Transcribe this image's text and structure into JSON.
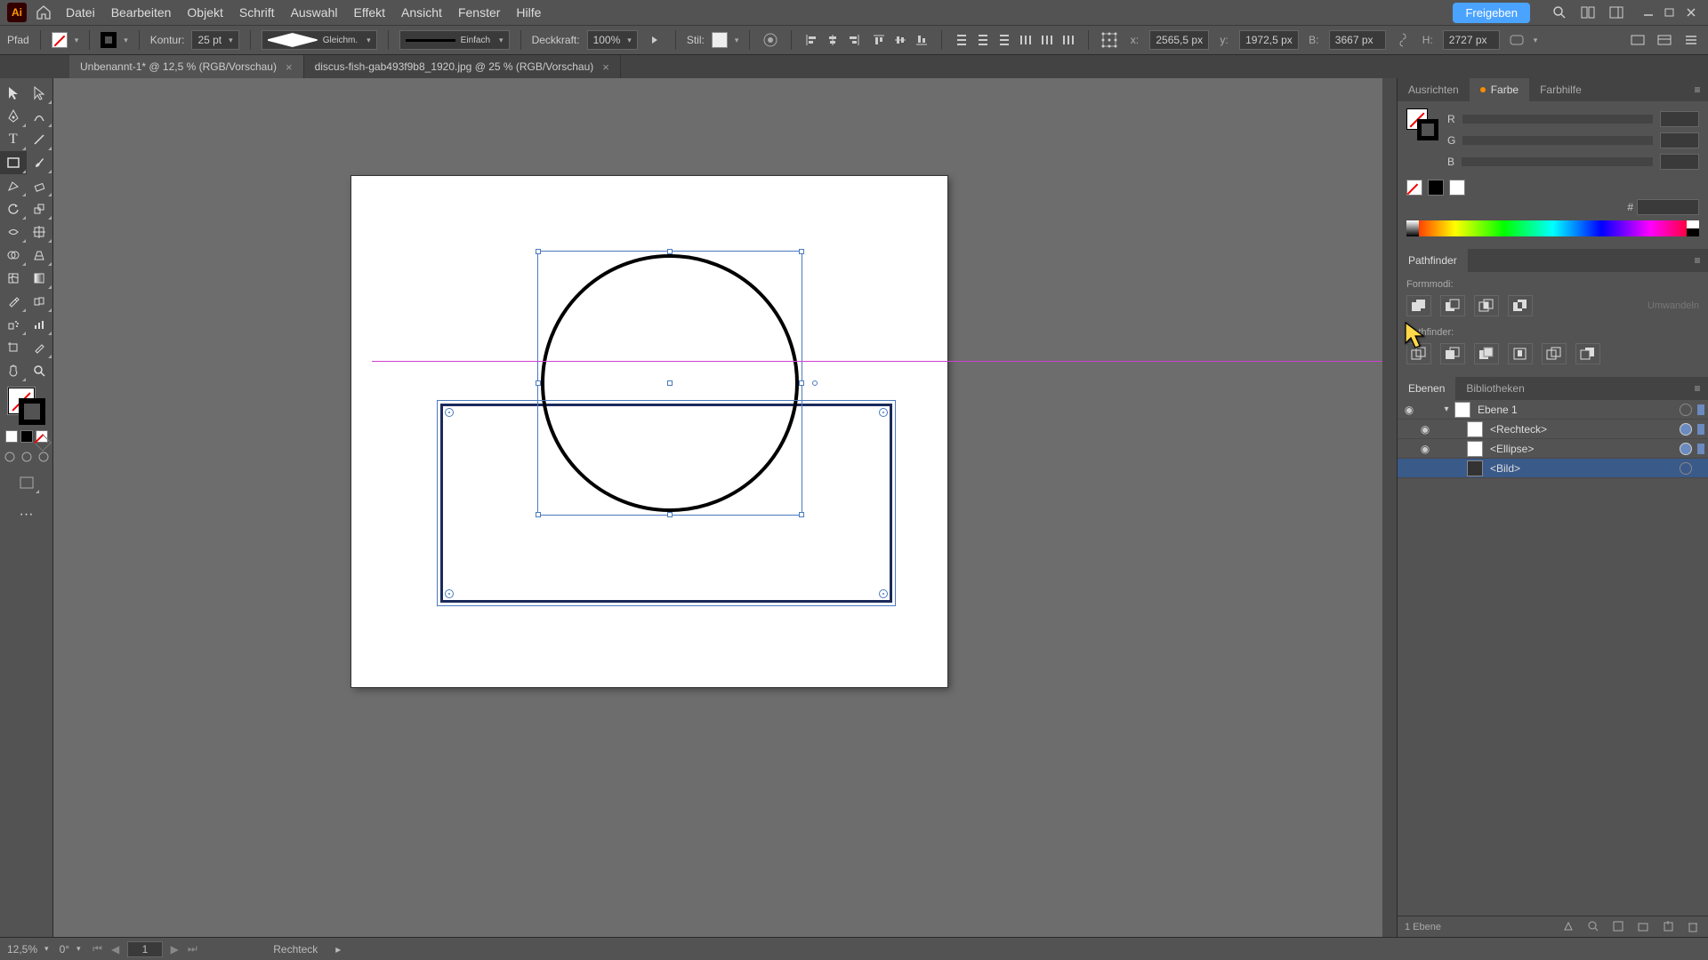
{
  "menubar": {
    "items": [
      "Datei",
      "Bearbeiten",
      "Objekt",
      "Schrift",
      "Auswahl",
      "Effekt",
      "Ansicht",
      "Fenster",
      "Hilfe"
    ],
    "share": "Freigeben"
  },
  "controlbar": {
    "selection_type": "Pfad",
    "kontur_label": "Kontur:",
    "kontur_value": "25 pt",
    "profile": "Gleichm.",
    "brush": "Einfach",
    "opacity_label": "Deckkraft:",
    "opacity_value": "100%",
    "style_label": "Stil:",
    "x_label": "x:",
    "x_value": "2565,5 px",
    "y_label": "y:",
    "y_value": "1972,5 px",
    "w_label": "B:",
    "w_value": "3667 px",
    "h_label": "H:",
    "h_value": "2727 px"
  },
  "tabs": [
    {
      "label": "Unbenannt-1* @ 12,5 % (RGB/Vorschau)",
      "active": true
    },
    {
      "label": "discus-fish-gab493f9b8_1920.jpg @ 25 % (RGB/Vorschau)",
      "active": false
    }
  ],
  "right": {
    "color_tabs": [
      "Ausrichten",
      "Farbe",
      "Farbhilfe"
    ],
    "color_active": 1,
    "rgb_labels": [
      "R",
      "G",
      "B"
    ],
    "hex_label": "#",
    "pathfinder_title": "Pathfinder",
    "pathfinder_section1": "Formmodi:",
    "pathfinder_expand": "Umwandeln",
    "pathfinder_section2": "Pathfinder:",
    "layers_tabs": [
      "Ebenen",
      "Bibliotheken"
    ],
    "layers_active": 0,
    "layers": {
      "top": "Ebene 1",
      "items": [
        "<Rechteck>",
        "<Ellipse>",
        "<Bild>"
      ]
    },
    "layers_footer": "1 Ebene"
  },
  "statusbar": {
    "zoom": "12,5%",
    "rotate": "0°",
    "artboard": "1",
    "tool": "Rechteck"
  },
  "colors": {
    "accent": "#4aa3ff",
    "selection": "#4a7abf",
    "guide": "#d040d0"
  }
}
